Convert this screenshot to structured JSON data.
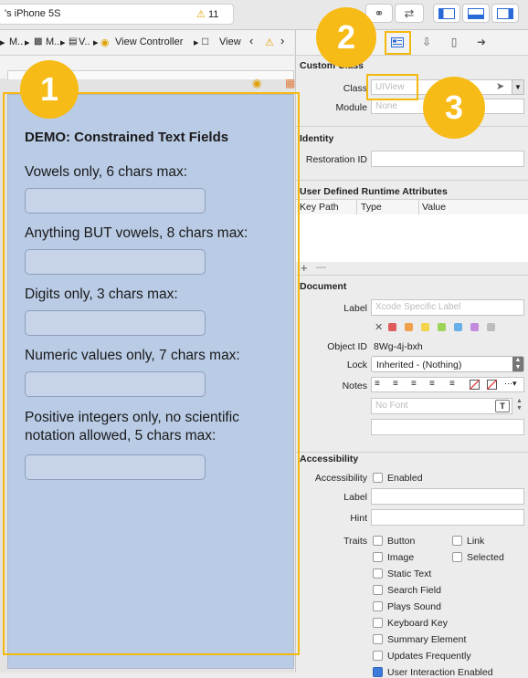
{
  "toolbar": {
    "scheme": "'s iPhone 5S",
    "warnings": "11"
  },
  "jumpbar": {
    "items": [
      "M..",
      "M..",
      "V..",
      "View Controller",
      "View"
    ]
  },
  "canvas": {
    "demo_title": "DEMO: Constrained Text Fields",
    "labels": [
      "Vowels only, 6 chars max:",
      "Anything BUT vowels, 8 chars max:",
      "Digits only, 3 chars max:",
      "Numeric values only, 7 chars max:",
      "Positive integers only, no scientific",
      "notation allowed, 5 chars max:"
    ]
  },
  "inspector": {
    "custom_class": {
      "header": "Custom Class",
      "class_label": "Class",
      "class_placeholder": "UIView",
      "module_label": "Module",
      "module_value": "None"
    },
    "identity": {
      "header": "Identity",
      "restoration_label": "Restoration ID"
    },
    "udra": {
      "header": "User Defined Runtime Attributes",
      "col_key": "Key Path",
      "col_type": "Type",
      "col_value": "Value",
      "add": "+",
      "remove": "—"
    },
    "document": {
      "header": "Document",
      "label_label": "Label",
      "label_placeholder": "Xcode Specific Label",
      "object_id_label": "Object ID",
      "object_id_value": "8Wg-4j-bxh",
      "lock_label": "Lock",
      "lock_value": "Inherited - (Nothing)",
      "notes_label": "Notes",
      "font_placeholder": "No Font"
    },
    "accessibility": {
      "header": "Accessibility",
      "accessibility_label": "Accessibility",
      "enabled": "Enabled",
      "label_label": "Label",
      "hint_label": "Hint",
      "traits_label": "Traits",
      "traits": [
        "Button",
        "Link",
        "Image",
        "Selected",
        "Static Text",
        "Search Field",
        "Plays Sound",
        "Keyboard Key",
        "Summary Element",
        "Updates Frequently",
        "User Interaction Enabled"
      ]
    }
  },
  "callouts": {
    "one": "1",
    "two": "2",
    "three": "3"
  },
  "colors": {
    "callout": "#f7bb17",
    "view_bg": "#b9cbe5",
    "label_swatches": [
      "#e05b5b",
      "#f0a04a",
      "#f2d54a",
      "#9ed35a",
      "#6ab0e8",
      "#c48ae0",
      "#bdbdbd"
    ]
  }
}
